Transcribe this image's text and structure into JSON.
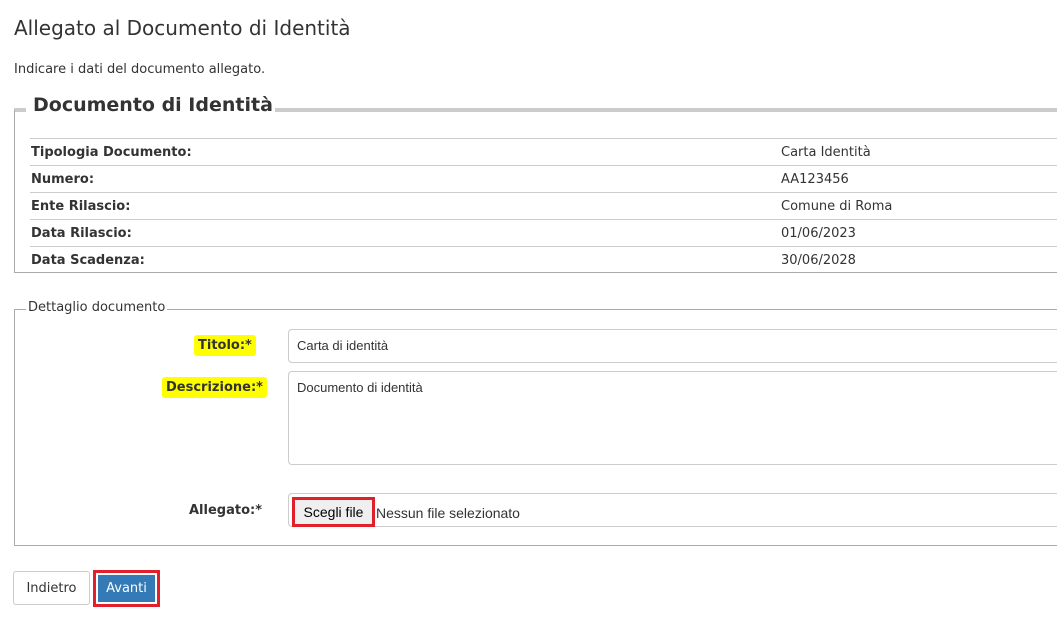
{
  "page": {
    "title": "Allegato al Documento di Identità",
    "intro": "Indicare i dati del documento allegato."
  },
  "identity_document": {
    "legend": "Documento di Identità",
    "rows": [
      {
        "label": "Tipologia Documento:",
        "value": "Carta Identità"
      },
      {
        "label": "Numero:",
        "value": "AA123456"
      },
      {
        "label": "Ente Rilascio:",
        "value": "Comune di Roma"
      },
      {
        "label": "Data Rilascio:",
        "value": "01/06/2023"
      },
      {
        "label": "Data Scadenza:",
        "value": "30/06/2028"
      }
    ]
  },
  "detail": {
    "legend": "Dettaglio documento",
    "title_label": "Titolo:*",
    "title_value": "Carta di identità",
    "description_label": "Descrizione:*",
    "description_value": "Documento di identità",
    "attachment_label": "Allegato:*",
    "file_button_label": "Scegli file",
    "file_status": "Nessun file selezionato"
  },
  "actions": {
    "back_label": "Indietro",
    "next_label": "Avanti"
  },
  "colors": {
    "primary": "#337ab7",
    "highlight": "#ffff00",
    "annotation_red": "#e0202a"
  }
}
